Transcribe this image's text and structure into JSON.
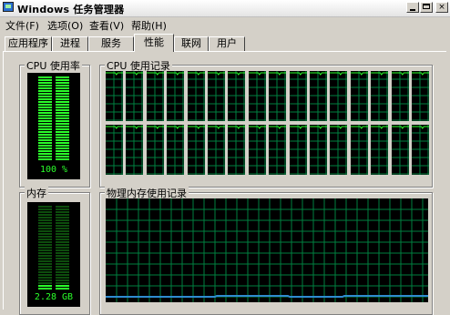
{
  "window": {
    "title": "Windows 任务管理器",
    "controls": {
      "minimize": "",
      "maximize": "",
      "close": "×"
    }
  },
  "menu": [
    {
      "label": "文件(F)"
    },
    {
      "label": "选项(O)"
    },
    {
      "label": "查看(V)"
    },
    {
      "label": "帮助(H)"
    }
  ],
  "tabs": [
    {
      "label": "应用程序",
      "active": false
    },
    {
      "label": "进程",
      "active": false
    },
    {
      "label": "服务",
      "active": false
    },
    {
      "label": "性能",
      "active": true
    },
    {
      "label": "联网",
      "active": false
    },
    {
      "label": "用户",
      "active": false
    }
  ],
  "cpu_usage": {
    "label": "CPU 使用率",
    "value_text": "100 %",
    "level": 1.0
  },
  "cpu_history": {
    "label": "CPU 使用记录",
    "cores": 32,
    "level": 0.97
  },
  "memory": {
    "label": "内存",
    "value_text": "2.28 GB",
    "level": 0.06
  },
  "memory_history": {
    "label": "物理内存使用记录",
    "level": 0.05
  },
  "colors": {
    "graph_bg": "#000000",
    "grid": "#008040",
    "meter_on": "#2aff2a",
    "meter_off": "#0d4d0d",
    "mem_line": "#2f8bd0"
  }
}
